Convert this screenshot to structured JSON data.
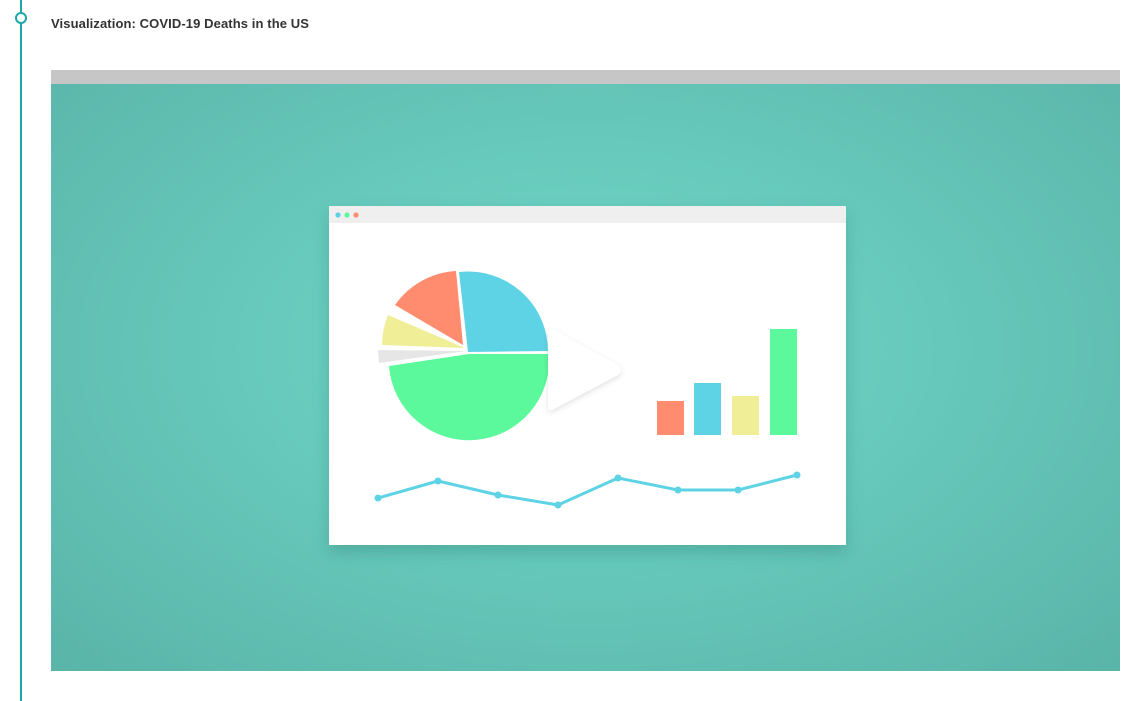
{
  "section": {
    "title": "Visualization: COVID-19 Deaths in the US"
  },
  "player": {
    "type": "video",
    "controls_icon": "play-icon"
  },
  "colors": {
    "rail": "#1aa8a8",
    "stage": "#66c9bb",
    "pie_blue": "#5fd3e6",
    "pie_green": "#5cf99c",
    "pie_orange": "#ff8c6e",
    "pie_yellow": "#f0ef98",
    "pie_gray": "#e6e6e6",
    "bar_orange": "#ff8c6e",
    "bar_blue": "#5fd3e6",
    "bar_yellow": "#f0ef98",
    "bar_green": "#5cf99c",
    "line": "#5fd3e6"
  }
}
